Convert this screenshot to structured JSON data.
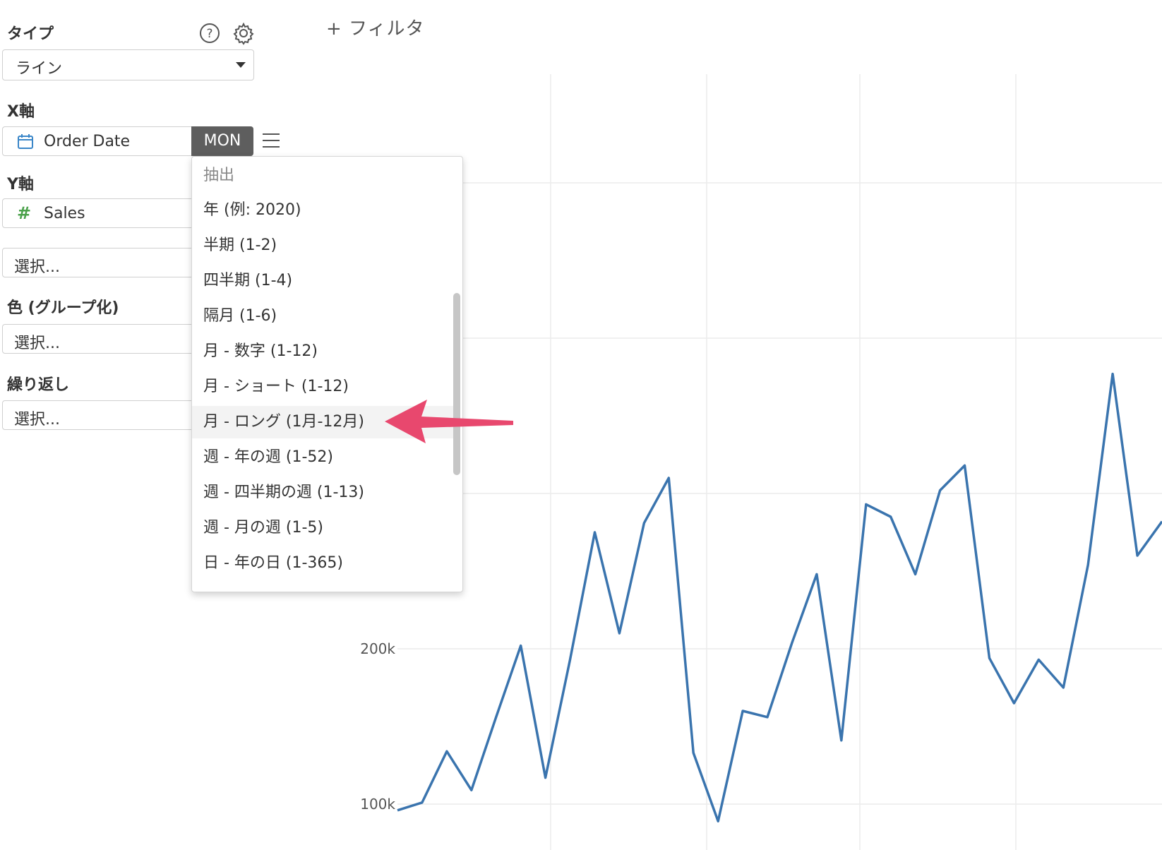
{
  "panel": {
    "type": {
      "label": "タイプ",
      "value": "ライン"
    },
    "x_axis": {
      "label": "X軸",
      "field": "Order Date",
      "granularity": "MON"
    },
    "y_axis": {
      "label": "Y軸",
      "field": "Sales",
      "field_icon": "#",
      "secondary_placeholder": "選択..."
    },
    "color": {
      "label": "色 (グループ化)",
      "placeholder": "選択..."
    },
    "repeat": {
      "label": "繰り返し",
      "placeholder": "選択..."
    }
  },
  "filter": {
    "add_label": "+ フィルタ"
  },
  "granularity_menu": {
    "header": "抽出",
    "items": [
      "年 (例: 2020)",
      "半期 (1-2)",
      "四半期 (1-4)",
      "隔月 (1-6)",
      "月 - 数字 (1-12)",
      "月 - ショート (1-12)",
      "月 - ロング (1月-12月)",
      "週 - 年の週 (1-52)",
      "週 - 四半期の週 (1-13)",
      "週 - 月の週 (1-5)",
      "日 - 年の日 (1-365)"
    ],
    "selected_index": 6,
    "highlight_arrow_color": "#e8486e"
  },
  "chart_data": {
    "type": "line",
    "y_ticks": [
      "100k",
      "200k"
    ],
    "ylim": [
      70000,
      570000
    ],
    "grid": true,
    "line_color": "#3a74ae",
    "values": [
      96000,
      101000,
      134000,
      109000,
      156000,
      202000,
      117000,
      193000,
      275000,
      210000,
      281000,
      310000,
      133000,
      89000,
      160000,
      156000,
      204000,
      248000,
      141000,
      293000,
      285000,
      248000,
      302000,
      318000,
      194000,
      165000,
      193000,
      175000,
      254000,
      377000,
      260000,
      282000
    ]
  }
}
